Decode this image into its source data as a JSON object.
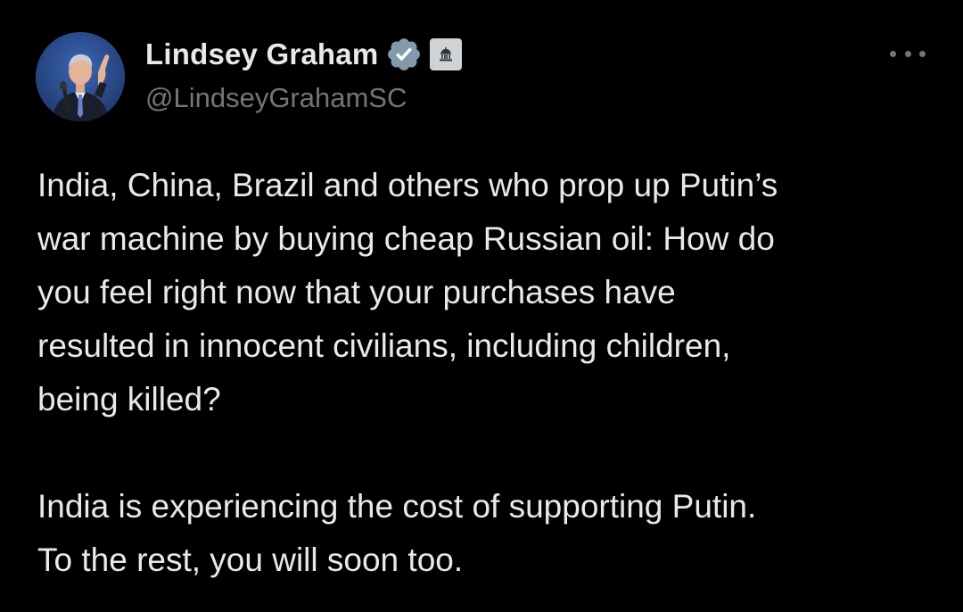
{
  "author": {
    "display_name": "Lindsey Graham",
    "handle": "@LindseyGrahamSC",
    "verified": true,
    "verified_badge_color": "#829aab",
    "affiliation_badge": "government-building-icon",
    "avatar": "profile-photo"
  },
  "actions": {
    "more_icon": "more-horizontal-icon"
  },
  "tweet": {
    "paragraphs": [
      {
        "lines": [
          "India, China, Brazil and others who prop up Putin’s",
          "war machine by buying cheap Russian oil: How do",
          "you feel right now that your purchases have",
          "resulted in innocent civilians, including children,",
          "being killed?"
        ]
      },
      {
        "lines": [
          "India is experiencing the cost of supporting Putin.",
          "To the rest, you will soon too."
        ]
      }
    ]
  },
  "theme": {
    "background": "#000000",
    "text_primary": "#e7e9ea",
    "text_secondary": "#71767b"
  }
}
